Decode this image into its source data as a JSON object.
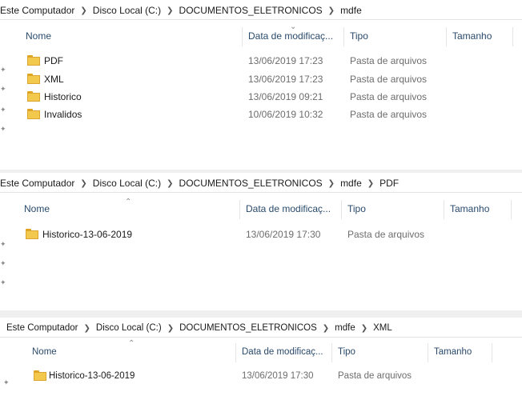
{
  "panes": [
    {
      "breadcrumb": [
        "Este Computador",
        "Disco Local (C:)",
        "DOCUMENTOS_ELETRONICOS",
        "mdfe"
      ],
      "columns": {
        "name": "Nome",
        "date": "Data de modificaç...",
        "type": "Tipo",
        "size": "Tamanho"
      },
      "sort_caret": "down",
      "rows": [
        {
          "name": "PDF",
          "date": "13/06/2019 17:23",
          "type": "Pasta de arquivos"
        },
        {
          "name": "XML",
          "date": "13/06/2019 17:23",
          "type": "Pasta de arquivos"
        },
        {
          "name": "Historico",
          "date": "13/06/2019 09:21",
          "type": "Pasta de arquivos"
        },
        {
          "name": "Invalidos",
          "date": "10/06/2019 10:32",
          "type": "Pasta de arquivos"
        }
      ]
    },
    {
      "breadcrumb": [
        "Este Computador",
        "Disco Local (C:)",
        "DOCUMENTOS_ELETRONICOS",
        "mdfe",
        "PDF"
      ],
      "columns": {
        "name": "Nome",
        "date": "Data de modificaç...",
        "type": "Tipo",
        "size": "Tamanho"
      },
      "sort_caret": "up",
      "rows": [
        {
          "name": "Historico-13-06-2019",
          "date": "13/06/2019 17:30",
          "type": "Pasta de arquivos"
        }
      ]
    },
    {
      "breadcrumb": [
        "Este Computador",
        "Disco Local (C:)",
        "DOCUMENTOS_ELETRONICOS",
        "mdfe",
        "XML"
      ],
      "columns": {
        "name": "Nome",
        "date": "Data de modificaç...",
        "type": "Tipo",
        "size": "Tamanho"
      },
      "sort_caret": "up",
      "rows": [
        {
          "name": "Historico-13-06-2019",
          "date": "13/06/2019 17:30",
          "type": "Pasta de arquivos"
        }
      ]
    }
  ],
  "icons": {
    "folder": "folder-icon",
    "pin": "pin-icon",
    "separator": "chevron-right-icon"
  },
  "colors": {
    "header_text": "#2a4a6b",
    "folder": "#f2c94c",
    "meta_text": "#6d6d6d"
  }
}
